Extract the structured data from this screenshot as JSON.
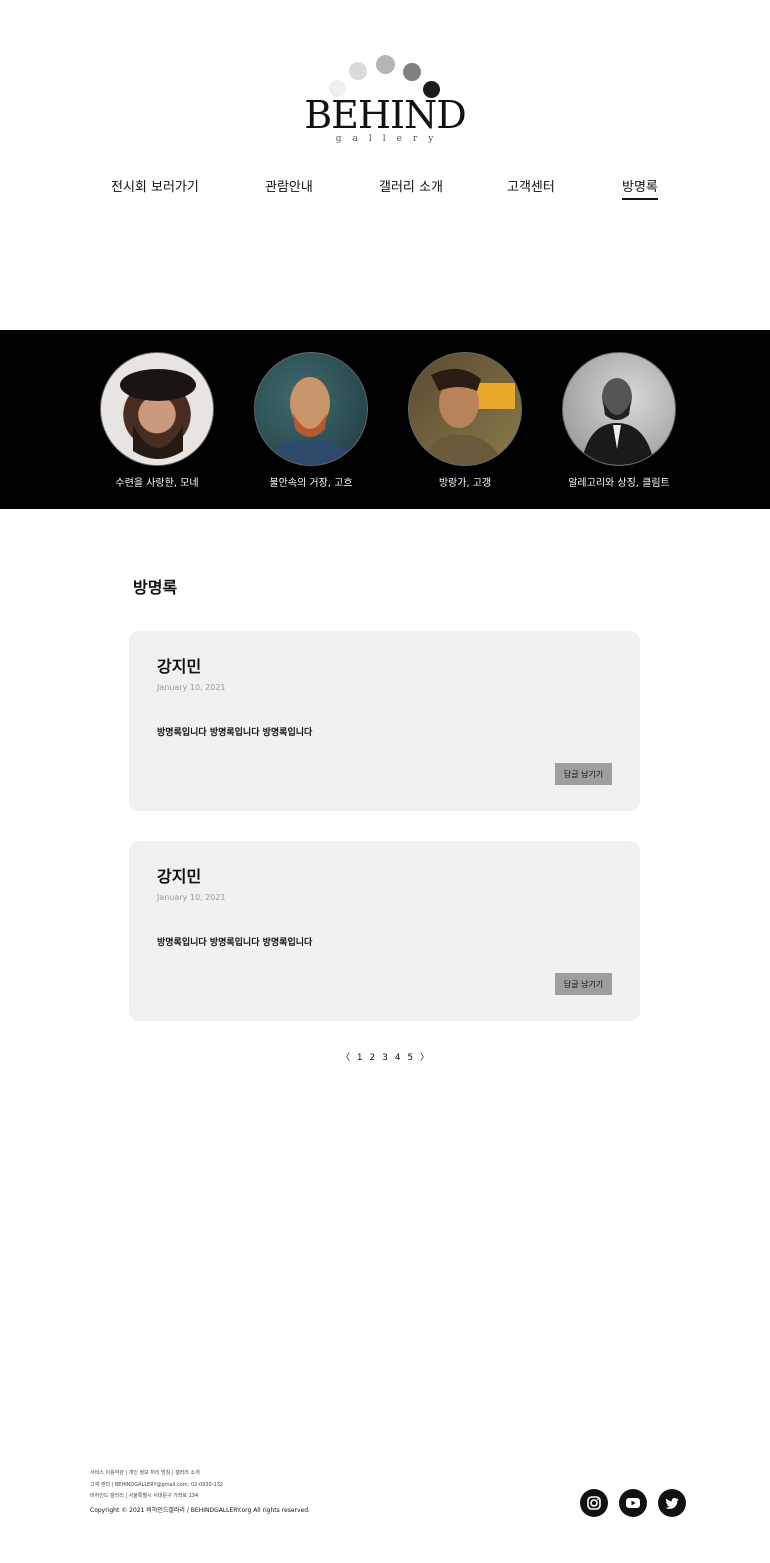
{
  "logo": {
    "word": "BEHIND",
    "sub": "gallery"
  },
  "nav": [
    {
      "label": "전시회 보러가기"
    },
    {
      "label": "관람안내"
    },
    {
      "label": "갤러리 소개"
    },
    {
      "label": "고객센터"
    },
    {
      "label": "방명록"
    }
  ],
  "artists": [
    {
      "caption": "수련을 사랑한, 모네"
    },
    {
      "caption": "불안속의 거장, 고흐"
    },
    {
      "caption": "방랑가, 고갱"
    },
    {
      "caption": "알레고리와 상징, 클림트"
    }
  ],
  "guestbook": {
    "title": "방명록",
    "entries": [
      {
        "name": "강지민",
        "date": "January 10, 2021",
        "message": "방명록입니다 방명록입니다 방명록입니다",
        "reply_label": "답글 남기기"
      },
      {
        "name": "강지민",
        "date": "January 10, 2021",
        "message": "방명록입니다 방명록입니다 방명록입니다",
        "reply_label": "답글 남기기"
      }
    ]
  },
  "pagination": {
    "prev": "〈",
    "pages": [
      "1",
      "2",
      "3",
      "4",
      "5"
    ],
    "next": "〉"
  },
  "footer": {
    "links": "서비스 이용약관 | 개인 정보 처리 방침 | 갤러리 소개",
    "contact": "고객 센터 | BEHINDGALLERY@gmail.com, 02-0930-132",
    "address": "비하인드 갤러리 | 서울특별시 서대문구 가좌로 134",
    "copyright": "Copyright © 2021 비하인드갤러리 / BEHINDGALLERY.org All rights reserved."
  },
  "social": [
    "instagram-icon",
    "youtube-icon",
    "twitter-icon"
  ]
}
